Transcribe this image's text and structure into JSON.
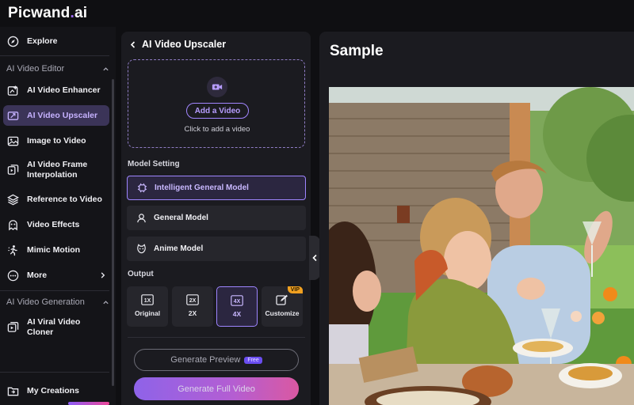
{
  "app": {
    "logo_main": "Picwand",
    "logo_dot": ".",
    "logo_ai": "ai"
  },
  "sidebar": {
    "explore": "Explore",
    "section_editor": "AI Video Editor",
    "items": [
      {
        "label": "AI Video Enhancer",
        "icon": "enhance-icon"
      },
      {
        "label": "AI Video Upscaler",
        "icon": "upscale-icon",
        "active": true
      },
      {
        "label": "Image to Video",
        "icon": "image-icon"
      },
      {
        "label": "AI Video Frame Interpolation",
        "icon": "frame-icon"
      },
      {
        "label": "Reference to Video",
        "icon": "layers-icon"
      },
      {
        "label": "Video Effects",
        "icon": "effects-icon"
      },
      {
        "label": "Mimic Motion",
        "icon": "motion-icon"
      },
      {
        "label": "More",
        "icon": "more-icon"
      }
    ],
    "section_generation": "AI Video Generation",
    "viral_label": "AI Viral Video Cloner",
    "my_creations": "My Creations"
  },
  "panel": {
    "title": "AI Video Upscaler",
    "upload": {
      "button": "Add a Video",
      "hint": "Click to add a video"
    },
    "model_setting_label": "Model Setting",
    "models": [
      {
        "label": "Intelligent General Model",
        "selected": true
      },
      {
        "label": "General Model",
        "selected": false
      },
      {
        "label": "Anime Model",
        "selected": false
      }
    ],
    "output_label": "Output",
    "outputs": [
      {
        "badge": "1X",
        "label": "Original"
      },
      {
        "badge": "2X",
        "label": "2X"
      },
      {
        "badge": "4X",
        "label": "4X",
        "selected": true
      },
      {
        "label": "Customize",
        "vip": "VIP"
      }
    ],
    "preview_button": "Generate Preview",
    "free_badge": "Free",
    "full_button": "Generate Full Video"
  },
  "preview": {
    "title": "Sample"
  },
  "colors": {
    "accent": "#9e85ff",
    "active_bg": "#3b3458",
    "vip": "#f0a020",
    "pink": "#ef5fb0"
  }
}
